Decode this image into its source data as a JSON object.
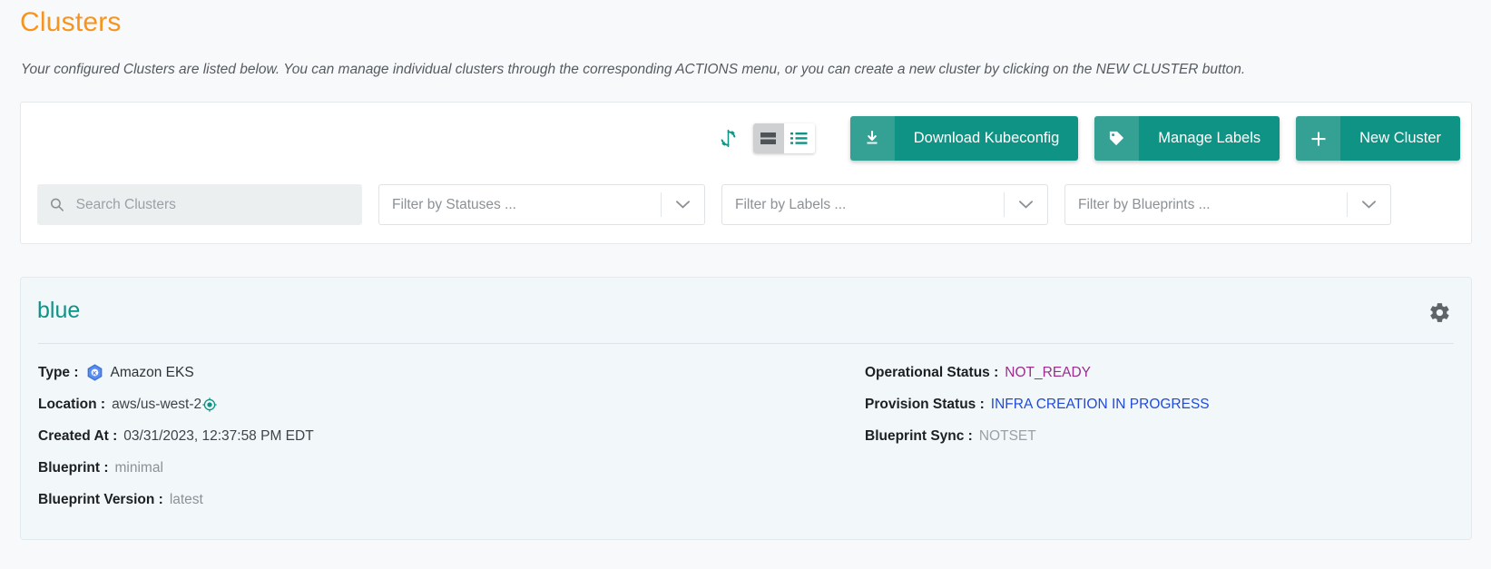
{
  "header": {
    "title": "Clusters",
    "description": "Your configured Clusters are listed below. You can manage individual clusters through the corresponding ACTIONS menu, or you can create a new cluster by clicking on the NEW CLUSTER button."
  },
  "toolbar": {
    "refresh_icon": "refresh-icon",
    "view_card_icon": "card-view-icon",
    "view_list_icon": "list-view-icon",
    "buttons": [
      {
        "label": "Download Kubeconfig",
        "icon": "download-icon"
      },
      {
        "label": "Manage Labels",
        "icon": "tag-icon"
      },
      {
        "label": "New Cluster",
        "icon": "plus-icon"
      }
    ]
  },
  "filters": {
    "search": {
      "placeholder": "Search Clusters",
      "value": "",
      "icon": "search-icon"
    },
    "statuses": {
      "placeholder": "Filter by Statuses ...",
      "value": "Filter by Statuses ..."
    },
    "labels": {
      "placeholder": "Filter by Labels ...",
      "value": "Filter by Labels ..."
    },
    "blueprints": {
      "placeholder": "Filter by Blueprints ...",
      "value": "Filter by Blueprints ..."
    }
  },
  "cluster": {
    "name": "blue",
    "settings_icon": "gear-icon",
    "left": {
      "type_label": "Type :",
      "type_value": "Amazon EKS",
      "type_icon": "kubernetes-eks-icon",
      "location_label": "Location :",
      "location_value": "aws/us-west-2",
      "location_icon": "target-icon",
      "created_label": "Created At :",
      "created_value": "03/31/2023, 12:37:58 PM EDT",
      "blueprint_label": "Blueprint :",
      "blueprint_value": "minimal",
      "blueprint_version_label": "Blueprint Version :",
      "blueprint_version_value": "latest"
    },
    "right": {
      "operational_label": "Operational Status :",
      "operational_value": "NOT_READY",
      "provision_label": "Provision Status :",
      "provision_value": "INFRA CREATION IN PROGRESS",
      "sync_label": "Blueprint Sync :",
      "sync_value": "NOTSET"
    }
  },
  "colors": {
    "accent_orange": "#f7941e",
    "teal": "#0e9384",
    "teal_light": "#35a094",
    "status_not_ready": "#9b2d8c",
    "status_provision": "#1f4bdb",
    "status_notset": "#9aa1a6"
  }
}
